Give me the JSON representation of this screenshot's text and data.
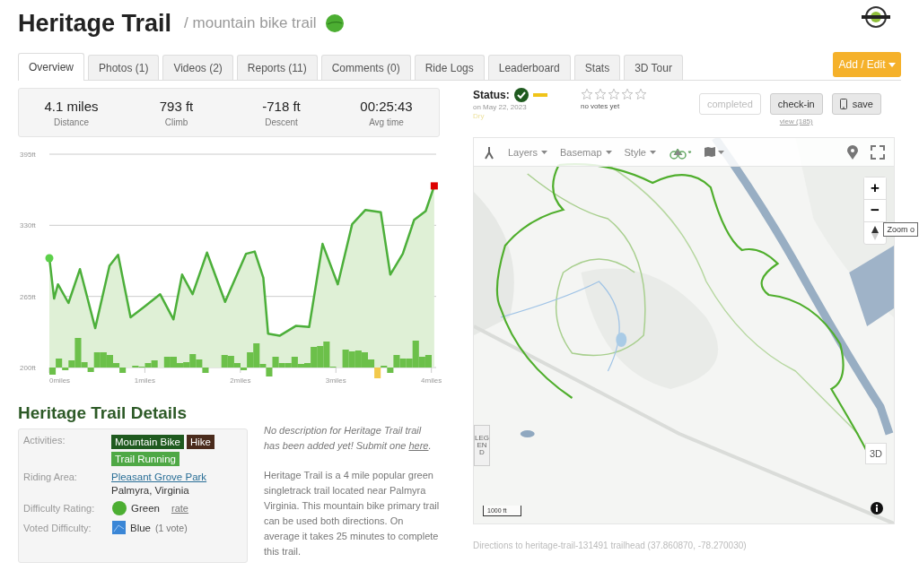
{
  "header": {
    "title": "Heritage Trail",
    "subtitle": "/ mountain bike trail"
  },
  "tabs": [
    {
      "label": "Overview",
      "selected": true
    },
    {
      "label": "Photos (1)",
      "selected": false
    },
    {
      "label": "Videos (2)",
      "selected": false
    },
    {
      "label": "Reports (11)",
      "selected": false
    },
    {
      "label": "Comments (0)",
      "selected": false
    },
    {
      "label": "Ride Logs",
      "selected": false
    },
    {
      "label": "Leaderboard",
      "selected": false
    },
    {
      "label": "Stats",
      "selected": false
    },
    {
      "label": "3D Tour",
      "selected": false
    }
  ],
  "add_edit_button": "Add / Edit",
  "stats": [
    {
      "value": "4.1 miles",
      "label": "Distance"
    },
    {
      "value": "793 ft",
      "label": "Climb"
    },
    {
      "value": "-718 ft",
      "label": "Descent"
    },
    {
      "value": "00:25:43",
      "label": "Avg time"
    }
  ],
  "elevation": {
    "chart_data": {
      "type": "area",
      "xlim": [
        0,
        4.05
      ],
      "ylim": [
        200,
        395
      ],
      "xticks": [
        {
          "value": 0,
          "label": "0miles"
        },
        {
          "value": 1,
          "label": "1miles"
        },
        {
          "value": 2,
          "label": "2miles"
        },
        {
          "value": 3,
          "label": "3miles"
        },
        {
          "value": 4,
          "label": "4miles"
        }
      ],
      "yticks": [
        {
          "value": 200,
          "label": "200ft"
        },
        {
          "value": 265,
          "label": "265ft"
        },
        {
          "value": 330,
          "label": "330ft"
        },
        {
          "value": 395,
          "label": "395ft"
        }
      ],
      "x": [
        0,
        0.05,
        0.09,
        0.2,
        0.32,
        0.48,
        0.63,
        0.72,
        0.85,
        1.0,
        1.16,
        1.3,
        1.39,
        1.5,
        1.65,
        1.84,
        2.06,
        2.15,
        2.24,
        2.29,
        2.41,
        2.58,
        2.72,
        2.86,
        3.02,
        3.17,
        3.31,
        3.47,
        3.57,
        3.7,
        3.82,
        3.94,
        4.03
      ],
      "series": [
        {
          "color": "#4caf3a",
          "values": [
            300,
            263,
            276,
            259,
            290,
            236,
            293,
            303,
            246,
            256,
            267,
            244,
            285,
            267,
            305,
            260,
            304,
            306,
            282,
            231,
            229,
            238,
            237,
            313,
            276,
            331,
            344,
            342,
            285,
            304,
            335,
            343,
            366
          ]
        }
      ]
    }
  },
  "details": {
    "heading": "Heritage Trail Details",
    "activities_label": "Activities:",
    "activities": [
      {
        "label": "Mountain Bike",
        "color": "#1f5a1f"
      },
      {
        "label": "Hike",
        "color": "#4a2b1c"
      },
      {
        "label": "Trail Running",
        "color": "#4ea845"
      }
    ],
    "riding_area_label": "Riding Area:",
    "riding_area": "Pleasant Grove Park",
    "location": "Palmyra, Virginia",
    "difficulty_label": "Difficulty Rating:",
    "difficulty": "Green",
    "rate_link": "rate",
    "voted_label": "Voted Difficulty:",
    "voted": "Blue",
    "voted_count": "(1 vote)"
  },
  "description": {
    "no_desc": "No description for Heritage Trail trail has been added yet! Submit one",
    "no_desc_link": "here",
    "no_desc_end": ".",
    "text": "Heritage Trail is a 4 mile popular green singletrack trail located near Palmyra Virginia. This mountain bike primary trail can be used both directions. On average it takes 25 minutes to complete this trail."
  },
  "status": {
    "label": "Status:",
    "date": "on May 22, 2023",
    "condition": "Dry"
  },
  "rating": {
    "stars": 0,
    "votes": "no votes yet"
  },
  "actions": {
    "completed": "completed",
    "checkin": "check-in",
    "views": "view (185)",
    "save": "save"
  },
  "map": {
    "toolbar": [
      {
        "label": "Layers"
      },
      {
        "label": "Basemap"
      },
      {
        "label": "Style"
      }
    ],
    "zoom_in": "+",
    "zoom_out": "−",
    "zoom_tooltip": "Zoom o",
    "legend": "LEGEND",
    "three_d": "3D",
    "scale": "1000 ft"
  },
  "directions": "Directions to heritage-trail-131491 trailhead (37.860870, -78.270030)"
}
